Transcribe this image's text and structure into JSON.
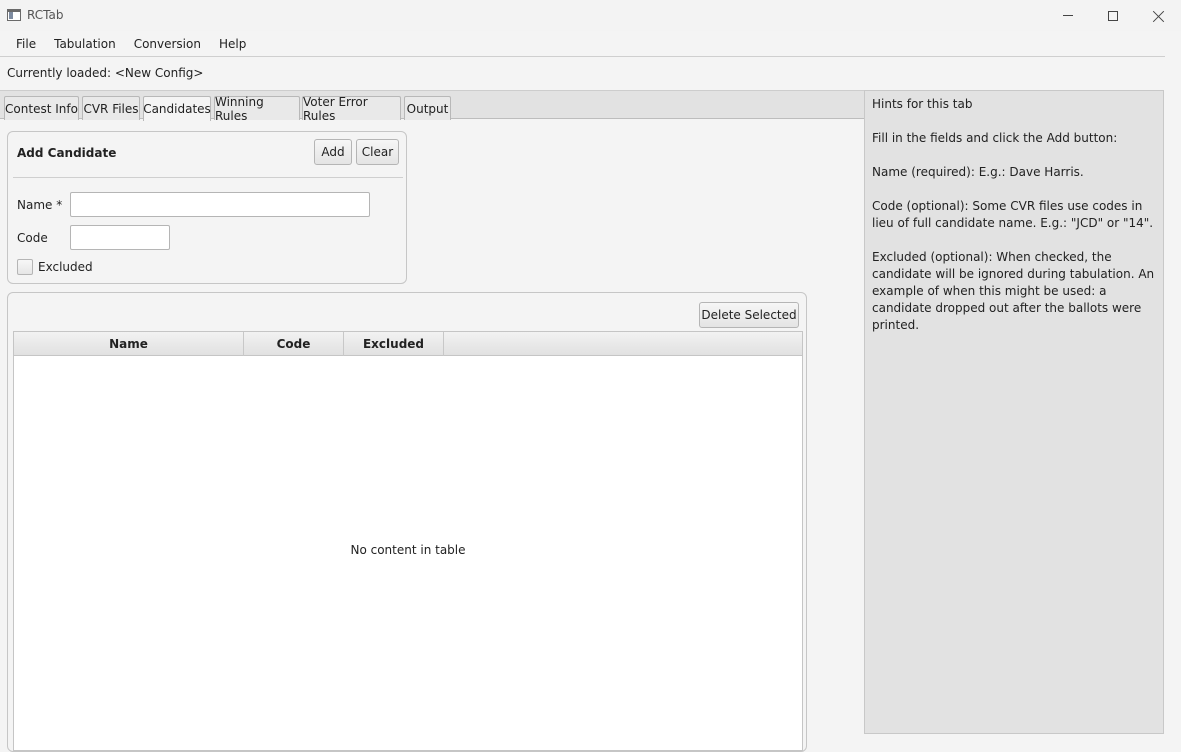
{
  "window": {
    "title": "RCTab"
  },
  "menu": [
    "File",
    "Tabulation",
    "Conversion",
    "Help"
  ],
  "status": {
    "loaded": "Currently loaded: <New Config>"
  },
  "tabs": [
    {
      "label": "Contest Info",
      "active": false
    },
    {
      "label": "CVR Files",
      "active": false
    },
    {
      "label": "Candidates",
      "active": true
    },
    {
      "label": "Winning Rules",
      "active": false
    },
    {
      "label": "Voter Error Rules",
      "active": false
    },
    {
      "label": "Output",
      "active": false
    }
  ],
  "add_candidate": {
    "title": "Add Candidate",
    "add_label": "Add",
    "clear_label": "Clear",
    "name_label": "Name *",
    "name_value": "",
    "code_label": "Code",
    "code_value": "",
    "excluded_label": "Excluded",
    "excluded_checked": false
  },
  "table": {
    "delete_label": "Delete Selected",
    "columns": [
      "Name",
      "Code",
      "Excluded"
    ],
    "rows": [],
    "empty_text": "No content in table"
  },
  "hints": {
    "title": "Hints for this tab",
    "paragraphs": [
      "Fill in the fields and click the Add button:",
      "Name (required): E.g.: Dave Harris.",
      "Code (optional): Some CVR files use codes in lieu of full candidate name. E.g.: \"JCD\" or \"14\".",
      "Excluded (optional): When checked, the candidate will be ignored during tabulation. An example of when this might be used: a candidate dropped out after the ballots were printed."
    ]
  }
}
